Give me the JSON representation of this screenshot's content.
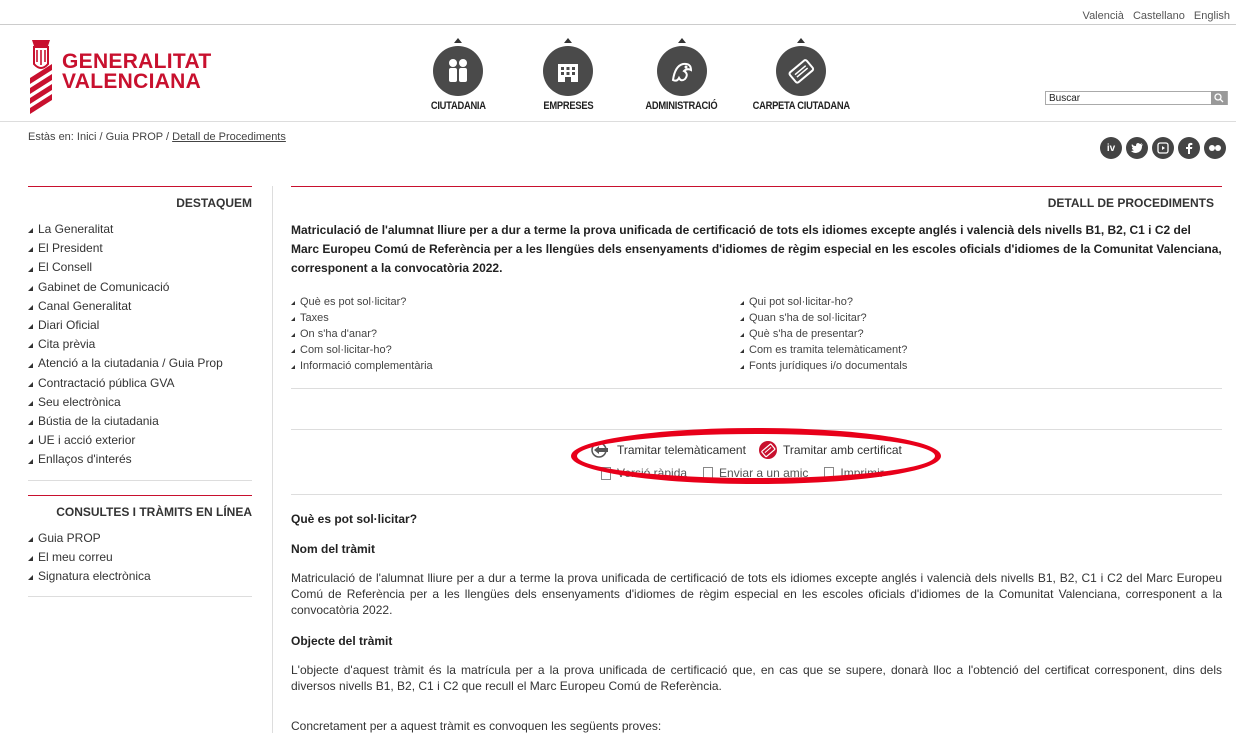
{
  "languages": [
    "Valencià",
    "Castellano",
    "English"
  ],
  "logo": {
    "line1": "GENERALITAT",
    "line2": "VALENCIANA"
  },
  "nav": [
    {
      "label": "CIUTADANIA",
      "icon": "citizens-icon"
    },
    {
      "label": "EMPRESES",
      "icon": "building-icon"
    },
    {
      "label": "ADMINISTRACIÓ",
      "icon": "administration-icon"
    },
    {
      "label": "CARPETA CIUTADANA",
      "icon": "folder-card-icon"
    }
  ],
  "search": {
    "placeholder": "Buscar"
  },
  "breadcrumb": {
    "prefix": "Estàs en:",
    "home": "Inici",
    "sep": "/",
    "guide": "Guia PROP",
    "current": "Detall de Procediments"
  },
  "social": [
    "iv",
    "t",
    "yt",
    "f",
    "fl"
  ],
  "sidebar": {
    "featured_title": "DESTAQUEM",
    "featured_items": [
      "La Generalitat",
      "El President",
      "El Consell",
      "Gabinet de Comunicació",
      "Canal Generalitat",
      "Diari Oficial",
      "Cita prèvia",
      "Atenció a la ciutadania / Guia Prop",
      "Contractació pública GVA",
      "Seu electrònica",
      "Bústia de la ciutadania",
      "UE i acció exterior",
      "Enllaços d'interés"
    ],
    "online_title": "CONSULTES I TRÀMITS EN LÍNEA",
    "online_items": [
      "Guia PROP",
      "El meu correu",
      "Signatura electrònica"
    ]
  },
  "main": {
    "title": "DETALL DE PROCEDIMENTS",
    "procedure_title": "Matriculació de l'alumnat lliure per a dur a terme la prova unificada de certificació de tots els idiomes excepte anglés i valencià dels nivells B1, B2, C1 i C2 del Marc Europeu Comú de Referència per a les llengües dels ensenyaments d'idiomes de règim especial en les escoles oficials d'idiomes de la Comunitat Valenciana, corresponent a la convocatòria 2022.",
    "links_left": [
      "Què es pot sol·licitar?",
      "Taxes",
      "On s'ha d'anar?",
      "Com sol·licitar-ho?",
      "Informació complementària"
    ],
    "links_right": [
      "Qui pot sol·licitar-ho?",
      "Quan s'ha de sol·licitar?",
      "Què s'ha de presentar?",
      "Com es tramita telemàticament?",
      "Fonts jurídiques i/o documentals"
    ],
    "actions": {
      "online": "Tramitar telemàticament",
      "certificate": "Tramitar amb certificat",
      "guide": "Versió ràpida",
      "send": "Enviar a un amic",
      "print": "Imprimir"
    },
    "section_heading": "Què es pot sol·licitar?",
    "name_heading": "Nom del tràmit",
    "name_text": "Matriculació de l'alumnat lliure per a dur a terme la prova unificada de certificació de tots els idiomes excepte anglés i valencià dels nivells B1, B2, C1 i C2 del Marc Europeu Comú de Referència per a les llengües dels ensenyaments d'idiomes de règim especial en les escoles oficials d'idiomes de la Comunitat Valenciana, corresponent a la convocatòria 2022.",
    "object_heading": "Objecte del tràmit",
    "object_text": "L'objecte d'aquest tràmit és la matrícula per a la prova unificada de certificació que, en cas que se supere, donarà lloc a l'obtenció del certificat corresponent, dins dels diversos nivells B1, B2, C1 i C2 que recull el Marc Europeu Comú de Referència.",
    "extra_text": "Concretament per a aquest tràmit es convoquen les següents proves:"
  },
  "colors": {
    "brand": "#c8102e",
    "highlight": "#e8001a",
    "nav_icon": "#4a4a4a"
  }
}
